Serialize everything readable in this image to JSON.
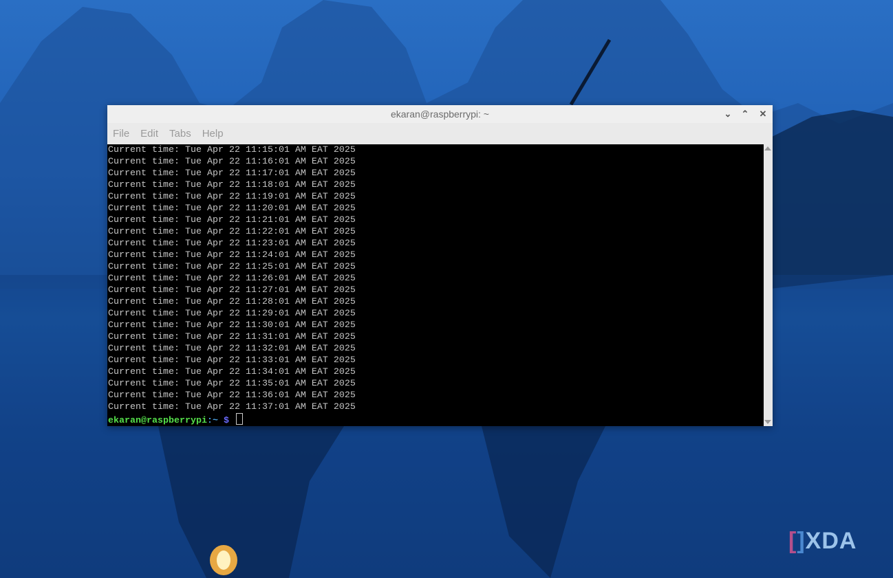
{
  "window": {
    "title": "ekaran@raspberrypi: ~"
  },
  "menu": [
    "File",
    "Edit",
    "Tabs",
    "Help"
  ],
  "terminal": {
    "lines": [
      "Current time: Tue Apr 22 11:15:01 AM EAT 2025",
      "Current time: Tue Apr 22 11:16:01 AM EAT 2025",
      "Current time: Tue Apr 22 11:17:01 AM EAT 2025",
      "Current time: Tue Apr 22 11:18:01 AM EAT 2025",
      "Current time: Tue Apr 22 11:19:01 AM EAT 2025",
      "Current time: Tue Apr 22 11:20:01 AM EAT 2025",
      "Current time: Tue Apr 22 11:21:01 AM EAT 2025",
      "Current time: Tue Apr 22 11:22:01 AM EAT 2025",
      "Current time: Tue Apr 22 11:23:01 AM EAT 2025",
      "Current time: Tue Apr 22 11:24:01 AM EAT 2025",
      "Current time: Tue Apr 22 11:25:01 AM EAT 2025",
      "Current time: Tue Apr 22 11:26:01 AM EAT 2025",
      "Current time: Tue Apr 22 11:27:01 AM EAT 2025",
      "Current time: Tue Apr 22 11:28:01 AM EAT 2025",
      "Current time: Tue Apr 22 11:29:01 AM EAT 2025",
      "Current time: Tue Apr 22 11:30:01 AM EAT 2025",
      "Current time: Tue Apr 22 11:31:01 AM EAT 2025",
      "Current time: Tue Apr 22 11:32:01 AM EAT 2025",
      "Current time: Tue Apr 22 11:33:01 AM EAT 2025",
      "Current time: Tue Apr 22 11:34:01 AM EAT 2025",
      "Current time: Tue Apr 22 11:35:01 AM EAT 2025",
      "Current time: Tue Apr 22 11:36:01 AM EAT 2025",
      "Current time: Tue Apr 22 11:37:01 AM EAT 2025"
    ],
    "prompt": {
      "user_host": "ekaran@raspberrypi",
      "path": ":~",
      "symbol": " $"
    }
  },
  "watermark": "XDA"
}
